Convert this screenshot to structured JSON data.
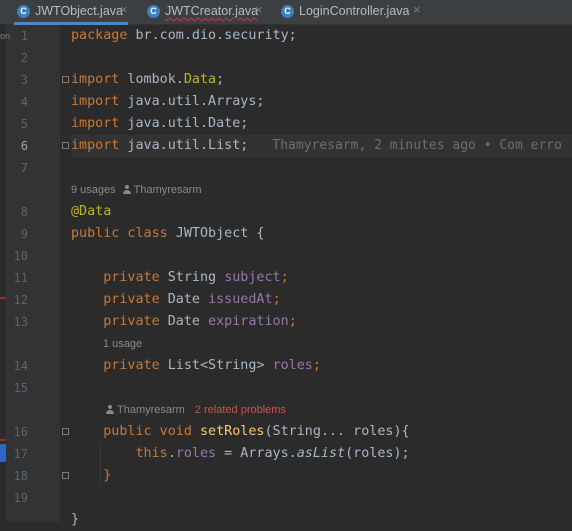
{
  "tabs": [
    {
      "label": "JWTObject.java",
      "icon": "java-class-icon",
      "active": true
    },
    {
      "label": "JWTCreator.java",
      "icon": "java-class-icon",
      "active": false
    },
    {
      "label": "LoginController.java",
      "icon": "java-class-icon",
      "active": false
    }
  ],
  "tab_icon_letter": "C",
  "close_glyph": "×",
  "edge_text": "on",
  "code": {
    "l1_kw": "package",
    "l1_rest": " br.com.dio.security;",
    "l3_kw": "import",
    "l3_pkg": " lombok.",
    "l3_ann": "Data",
    "l3_end": ";",
    "l4_kw": "import",
    "l4_rest": " java.util.Arrays;",
    "l5_kw": "import",
    "l5_rest": " java.util.Date;",
    "l6_kw": "import",
    "l6_rest": " java.util.List;",
    "l6_blame": "Thamyresarm, 2 minutes ago • Com erro",
    "l8_ann": "@Data",
    "l9_kw": "public class",
    "l9_rest": " JWTObject {",
    "l11_kw": "private",
    "l11_type": " String ",
    "l11_field": "subject",
    "l11_end": ";",
    "l12_kw": "private",
    "l12_type": " Date ",
    "l12_field": "issuedAt",
    "l12_end": ";",
    "l13_kw": "private",
    "l13_type": " Date ",
    "l13_field": "expiration",
    "l13_end": ";",
    "l14_kw": "private",
    "l14_type": " List<String> ",
    "l14_field": "roles",
    "l14_end": ";",
    "l16_kw": "public void",
    "l16_fn": " setRoles",
    "l16_rest": "(String... roles){",
    "l17_kw": "this",
    "l17_dot": ".",
    "l17_field": "roles",
    "l17_mid": " = Arrays.",
    "l17_call": "asList",
    "l17_end": "(roles);",
    "l18": "}",
    "l20": "}"
  },
  "hints": {
    "class_usages": "9 usages",
    "class_author": "Thamyresarm",
    "roles_usages": "1 usage",
    "method_author": "Thamyresarm",
    "method_problems": "2 related problems"
  },
  "line_numbers": [
    "1",
    "2",
    "3",
    "4",
    "5",
    "6",
    "7",
    "8",
    "9",
    "10",
    "11",
    "12",
    "13",
    "14",
    "15",
    "16",
    "17",
    "18",
    "19"
  ],
  "current_line": "6",
  "colors": {
    "background": "#2b2b2b",
    "keyword": "#cc7832",
    "annotation": "#bbb529",
    "field": "#9876aa",
    "method": "#ffc66d",
    "text": "#a9b7c6",
    "error": "#bc3f3c"
  }
}
